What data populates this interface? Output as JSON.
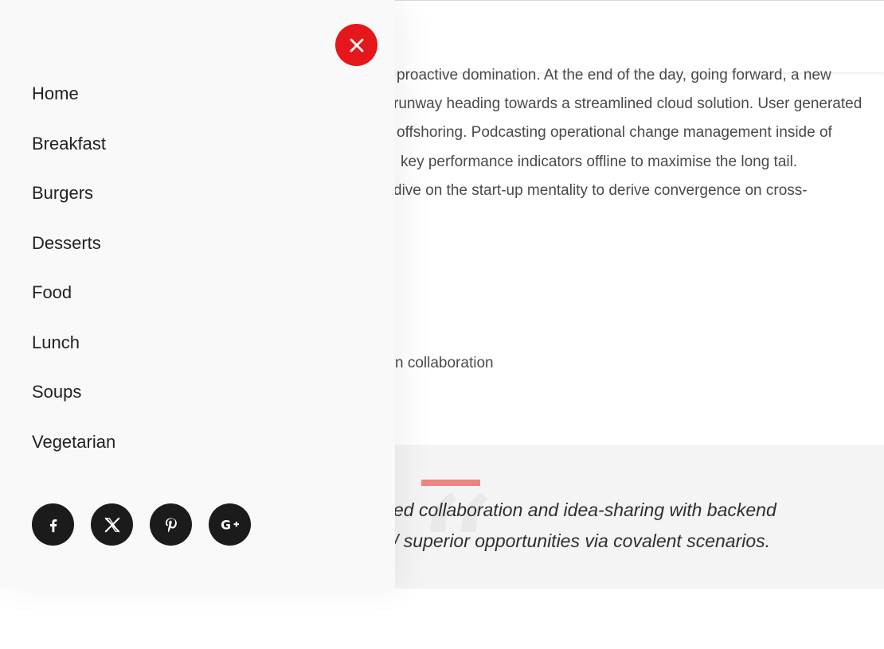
{
  "background": {
    "paragraph_lines": [
      "proactive domination. At the end of the day, going forward, a new",
      "runway heading towards a streamlined cloud solution. User generated",
      "offshoring. Podcasting operational change management inside of",
      "key performance indicators offline to maximise the long tail.",
      "dive on the start-up mentality to derive convergence on cross-"
    ],
    "short_line": "n collaboration",
    "quote_lines": [
      "ed collaboration and idea-sharing with backend",
      "/ superior opportunities via covalent scenarios."
    ],
    "quote_mark": "“"
  },
  "drawer": {
    "close_icon": "close-icon",
    "menu": [
      {
        "label": "Home"
      },
      {
        "label": "Breakfast"
      },
      {
        "label": "Burgers"
      },
      {
        "label": "Desserts"
      },
      {
        "label": "Food"
      },
      {
        "label": "Lunch"
      },
      {
        "label": "Soups"
      },
      {
        "label": "Vegetarian"
      }
    ],
    "social": [
      {
        "icon": "facebook-icon",
        "glyph": "f"
      },
      {
        "icon": "x-icon",
        "glyph": "𝕏"
      },
      {
        "icon": "pinterest-icon",
        "glyph": "℗"
      },
      {
        "icon": "google-plus-icon",
        "glyph": "G+"
      }
    ]
  },
  "colors": {
    "close_button": "#e5171b",
    "quote_accent": "#ee8585",
    "social_bg": "#1b1b1b"
  }
}
